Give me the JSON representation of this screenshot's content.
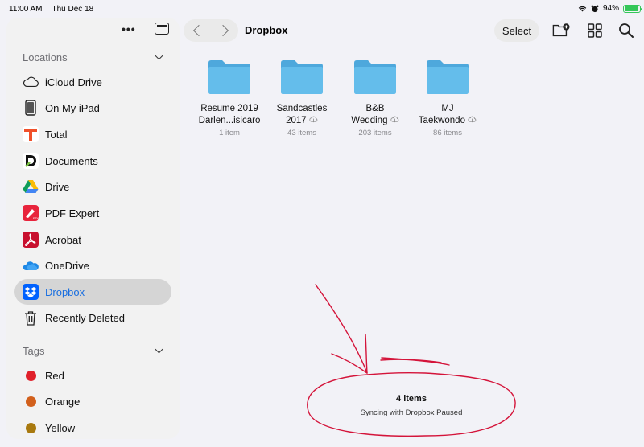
{
  "status": {
    "time": "11:00 AM",
    "date": "Thu Dec 18",
    "battery_pct": "94%",
    "battery_level": 0.94
  },
  "sidebar": {
    "locations_header": "Locations",
    "tags_header": "Tags",
    "locations": [
      {
        "label": "iCloud Drive",
        "icon": "cloud-icon"
      },
      {
        "label": "On My iPad",
        "icon": "ipad-icon"
      },
      {
        "label": "Total",
        "icon": "total-app-icon"
      },
      {
        "label": "Documents",
        "icon": "documents-app-icon"
      },
      {
        "label": "Drive",
        "icon": "google-drive-icon"
      },
      {
        "label": "PDF Expert",
        "icon": "pdf-expert-icon"
      },
      {
        "label": "Acrobat",
        "icon": "acrobat-icon"
      },
      {
        "label": "OneDrive",
        "icon": "onedrive-icon"
      },
      {
        "label": "Dropbox",
        "icon": "dropbox-icon",
        "active": true
      },
      {
        "label": "Recently Deleted",
        "icon": "trash-icon"
      }
    ],
    "tags": [
      {
        "label": "Red",
        "color": "#e0202a"
      },
      {
        "label": "Orange",
        "color": "#d2601c"
      },
      {
        "label": "Yellow",
        "color": "#a8790e"
      }
    ]
  },
  "toolbar": {
    "title": "Dropbox",
    "select_label": "Select"
  },
  "folders": [
    {
      "name_line1": "Resume 2019",
      "name_line2": "Darlen...isicaro",
      "count": "1 item",
      "cloud": false
    },
    {
      "name_line1": "Sandcastles",
      "name_line2": "2017",
      "count": "43 items",
      "cloud": true
    },
    {
      "name_line1": "B&B",
      "name_line2": "Wedding",
      "count": "203 items",
      "cloud": true
    },
    {
      "name_line1": "MJ",
      "name_line2": "Taekwondo",
      "count": "86 items",
      "cloud": true
    }
  ],
  "footer": {
    "item_count": "4 items",
    "sync_status": "Syncing with Dropbox Paused"
  },
  "colors": {
    "accent": "#1a6fe0",
    "folder": "#5ab4e6",
    "annotation": "#d4143a"
  }
}
